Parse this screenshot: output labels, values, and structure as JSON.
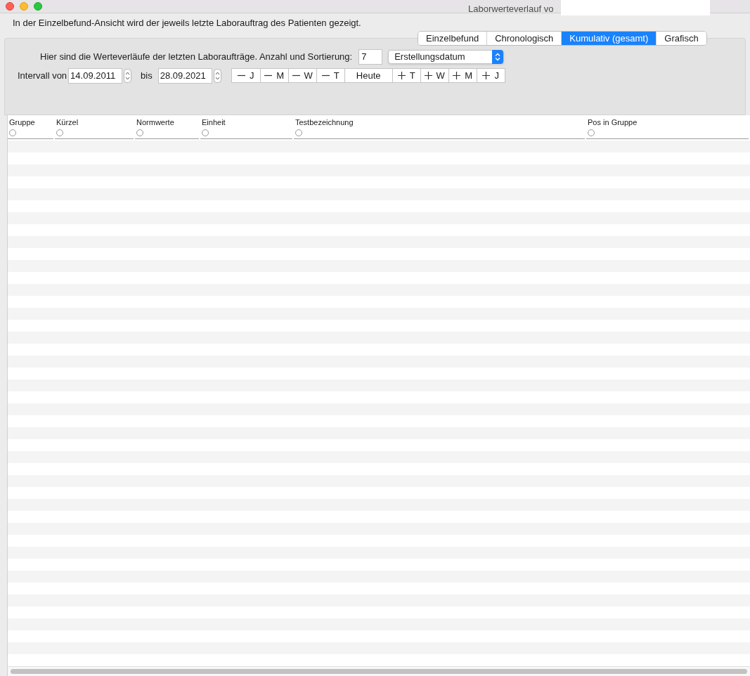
{
  "window": {
    "title": "Laborwerteverlauf vo"
  },
  "info_text": "In der Einzelbefund-Ansicht wird der jeweils letzte Laborauftrag des Patienten gezeigt.",
  "tabs": [
    {
      "label": "Einzelbefund",
      "selected": false
    },
    {
      "label": "Chronologisch",
      "selected": false
    },
    {
      "label": "Kumulativ (gesamt)",
      "selected": true
    },
    {
      "label": "Grafisch",
      "selected": false
    }
  ],
  "count_label": "Hier sind die Werteverläufe der letzten Laboraufträge. Anzahl und Sortierung:",
  "count_value": "7",
  "sort_select": "Erstellungsdatum",
  "interval_label": "Intervall von",
  "date_from": "14.09.2011",
  "to_label": "bis",
  "date_to": "28.09.2021",
  "step_buttons": [
    {
      "kind": "minus",
      "label": "J"
    },
    {
      "kind": "minus",
      "label": "M"
    },
    {
      "kind": "minus",
      "label": "W"
    },
    {
      "kind": "minus",
      "label": "T"
    },
    {
      "kind": "text",
      "label": "Heute"
    },
    {
      "kind": "plus",
      "label": "T"
    },
    {
      "kind": "plus",
      "label": "W"
    },
    {
      "kind": "plus",
      "label": "M"
    },
    {
      "kind": "plus",
      "label": "J"
    }
  ],
  "table": {
    "columns": [
      {
        "label": "Gruppe",
        "selected": false
      },
      {
        "label": "Kürzel",
        "selected": false
      },
      {
        "label": "Normwerte",
        "selected": false
      },
      {
        "label": "Einheit",
        "selected": false
      },
      {
        "label": "Testbezeichnung",
        "selected": false
      },
      {
        "label": "Pos in Gruppe",
        "selected": false
      }
    ]
  }
}
